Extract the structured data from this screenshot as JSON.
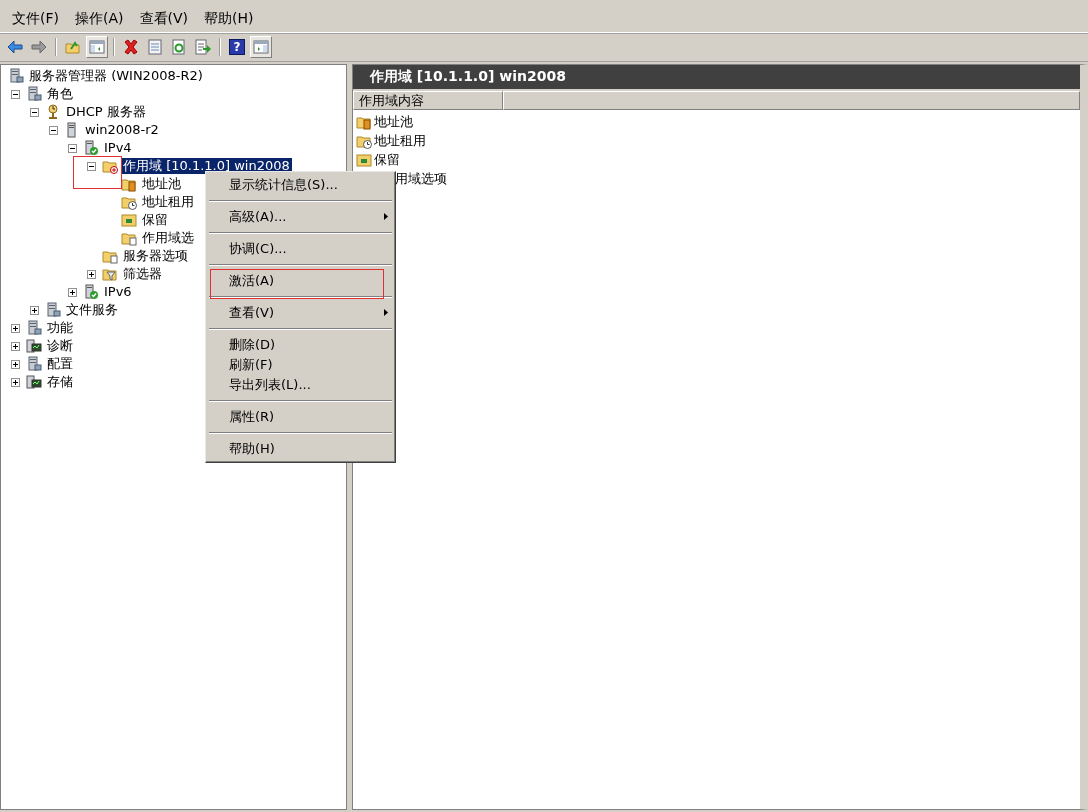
{
  "menubar": [
    "文件(F)",
    "操作(A)",
    "查看(V)",
    "帮助(H)"
  ],
  "toolbar": [
    {
      "kind": "back",
      "pressed": false
    },
    {
      "kind": "forward",
      "pressed": false
    },
    {
      "kind": "sep"
    },
    {
      "kind": "up",
      "pressed": false
    },
    {
      "kind": "tree",
      "pressed": true
    },
    {
      "kind": "sep"
    },
    {
      "kind": "delete",
      "pressed": false
    },
    {
      "kind": "properties",
      "pressed": false
    },
    {
      "kind": "refresh",
      "pressed": false
    },
    {
      "kind": "export",
      "pressed": false
    },
    {
      "kind": "sep"
    },
    {
      "kind": "help",
      "glyph": "?",
      "pressed": false
    },
    {
      "kind": "pane",
      "pressed": true
    }
  ],
  "tree": [
    {
      "label": "服务器管理器 (WIN2008-R2)",
      "kind": "server",
      "selected": false,
      "children": [
        {
          "label": "角色",
          "kind": "server",
          "selected": false,
          "expanded": true,
          "children": [
            {
              "label": "DHCP 服务器",
              "kind": "dhcp",
              "selected": false,
              "expanded": true,
              "children": [
                {
                  "label": "win2008-r2",
                  "kind": "tower",
                  "selected": false,
                  "expanded": true,
                  "children": [
                    {
                      "label": "IPv4",
                      "kind": "tower-ok",
                      "selected": false,
                      "expanded": true,
                      "children": [
                        {
                          "label": "作用域 [10.1.1.0] win2008",
                          "kind": "folder-scope",
                          "selected": true,
                          "marked": true,
                          "expanded": true,
                          "children": [
                            {
                              "label": "地址池",
                              "kind": "folder-book",
                              "selected": false
                            },
                            {
                              "label": "地址租用",
                              "kind": "folder-clock",
                              "selected": false
                            },
                            {
                              "label": "保留",
                              "kind": "folder-grid",
                              "selected": false
                            },
                            {
                              "label": "作用域选",
                              "kind": "folder-doc",
                              "selected": false
                            }
                          ]
                        },
                        {
                          "label": "服务器选项",
                          "kind": "folder-doc",
                          "selected": false
                        },
                        {
                          "label": "筛选器",
                          "kind": "funnel",
                          "selected": false,
                          "expanded": false
                        }
                      ]
                    },
                    {
                      "label": "IPv6",
                      "kind": "tower-ok",
                      "selected": false,
                      "expanded": false
                    }
                  ]
                }
              ]
            },
            {
              "label": "文件服务",
              "kind": "server",
              "selected": false,
              "expanded": false
            }
          ]
        },
        {
          "label": "功能",
          "kind": "server",
          "selected": false,
          "expanded": false
        },
        {
          "label": "诊断",
          "kind": "monitor",
          "selected": false,
          "expanded": false
        },
        {
          "label": "配置",
          "kind": "server",
          "selected": false,
          "expanded": false
        },
        {
          "label": "存储",
          "kind": "monitor",
          "selected": false,
          "expanded": false
        }
      ]
    }
  ],
  "result": {
    "title": "作用域 [10.1.1.0] win2008",
    "columns": [
      "作用域内容"
    ],
    "items": [
      {
        "label": "地址池",
        "kind": "folder-book"
      },
      {
        "label": "地址租用",
        "kind": "folder-clock"
      },
      {
        "label": "保留",
        "kind": "folder-grid"
      },
      {
        "label": "用域选项",
        "kind": "covered"
      }
    ]
  },
  "context_menu": [
    [
      {
        "label": "显示统计信息(S)...",
        "submenu": false
      }
    ],
    [
      {
        "label": "高级(A)...",
        "submenu": true
      }
    ],
    [
      {
        "label": "协调(C)...",
        "submenu": false
      }
    ],
    [
      {
        "label": "激活(A)",
        "submenu": false,
        "marked": true
      }
    ],
    [
      {
        "label": "查看(V)",
        "submenu": true
      }
    ],
    [
      {
        "label": "删除(D)",
        "submenu": false
      },
      {
        "label": "刷新(F)",
        "submenu": false
      },
      {
        "label": "导出列表(L)...",
        "submenu": false
      }
    ],
    [
      {
        "label": "属性(R)",
        "submenu": false
      }
    ],
    [
      {
        "label": "帮助(H)",
        "submenu": false
      }
    ]
  ]
}
